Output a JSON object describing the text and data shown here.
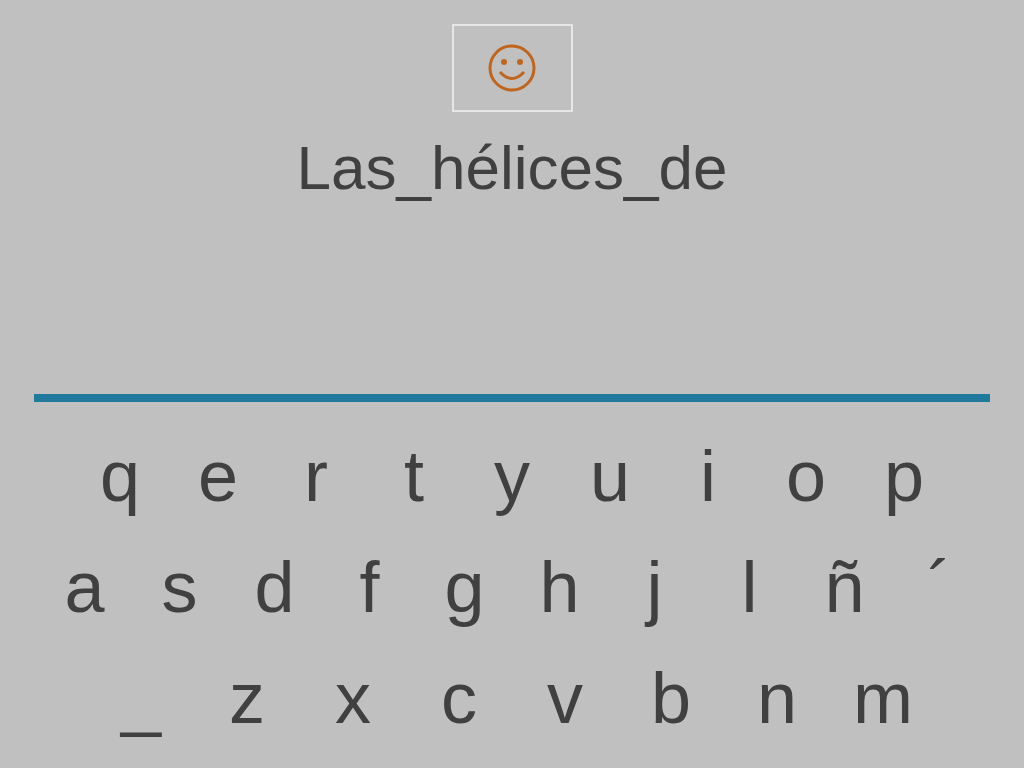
{
  "word": "Las_hélices_de",
  "keyboard": [
    [
      "q",
      "e",
      "r",
      "t",
      "y",
      "u",
      "i",
      "o",
      "p"
    ],
    [
      "a",
      "s",
      "d",
      "f",
      "g",
      "h",
      "j",
      "l",
      "ñ",
      "´"
    ],
    [
      "_",
      "z",
      "x",
      "c",
      "v",
      "b",
      "n",
      "m"
    ]
  ]
}
